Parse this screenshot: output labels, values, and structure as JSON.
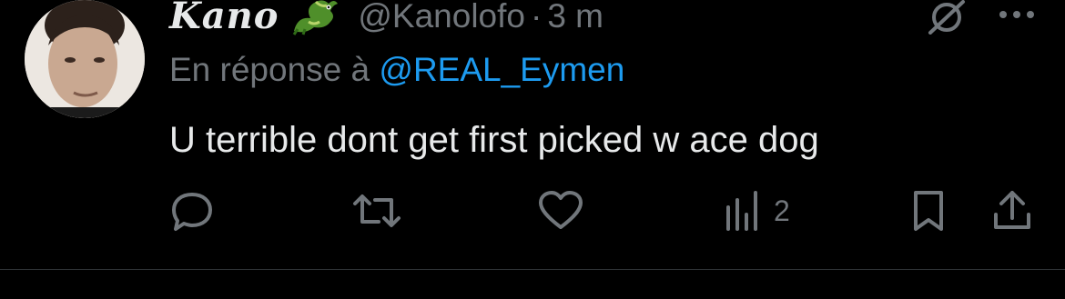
{
  "tweet": {
    "display_name": "Kano",
    "name_emoji": "dragon-emoji",
    "handle": "@Kanolofo",
    "separator": "·",
    "time": "3 m",
    "reply_prefix": "En réponse à ",
    "reply_mention": "@REAL_Eymen",
    "text": "U terrible dont get first picked w ace dog"
  },
  "actions": {
    "reply_icon": "reply-icon",
    "retweet_icon": "retweet-icon",
    "like_icon": "heart-icon",
    "views_icon": "views-icon",
    "views_count": "2",
    "bookmark_icon": "bookmark-icon",
    "share_icon": "share-icon"
  },
  "header_icons": {
    "grok": "grok-icon",
    "more": "more-icon"
  },
  "colors": {
    "background": "#000000",
    "text": "#e7e9ea",
    "secondary": "#71767b",
    "link": "#1d9bf0"
  }
}
